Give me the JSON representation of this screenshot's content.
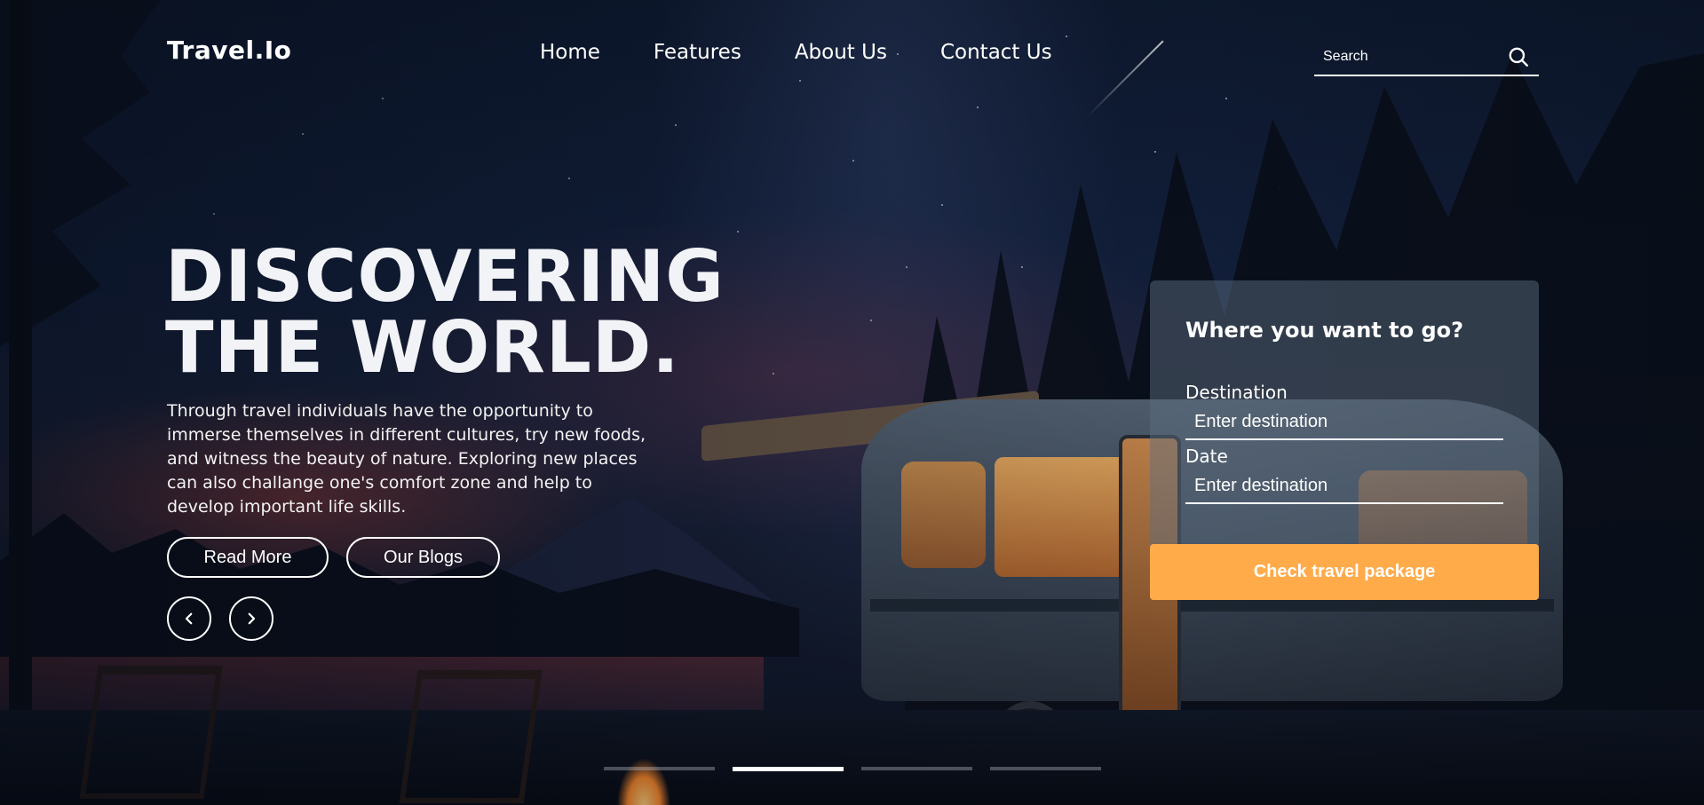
{
  "brand": {
    "logo": "Travel.Io"
  },
  "nav": {
    "items": [
      {
        "label": "Home"
      },
      {
        "label": "Features"
      },
      {
        "label": "About Us"
      },
      {
        "label": "Contact Us"
      }
    ]
  },
  "search": {
    "placeholder": "Search",
    "icon": "search-icon"
  },
  "hero": {
    "title_line1": "DISCOVERING",
    "title_line2": "THE WORLD.",
    "description": "Through travel individuals have the opportunity to immerse themselves in different cultures, try new foods, and witness the beauty of nature. Exploring new places can also challange one's comfort zone and help to develop important life skills.",
    "buttons": {
      "read_more": "Read More",
      "our_blogs": "Our Blogs"
    },
    "carousel": {
      "prev_icon": "chevron-left-icon",
      "next_icon": "chevron-right-icon"
    }
  },
  "booking": {
    "title": "Where you want to go?",
    "destination_label": "Destination",
    "destination_placeholder": "Enter destination",
    "date_label": "Date",
    "date_placeholder": "Enter destination",
    "submit_label": "Check travel package"
  },
  "slider": {
    "total": 4,
    "active_index": 2
  },
  "colors": {
    "accent": "#ffab4a",
    "text": "#ffffff"
  }
}
